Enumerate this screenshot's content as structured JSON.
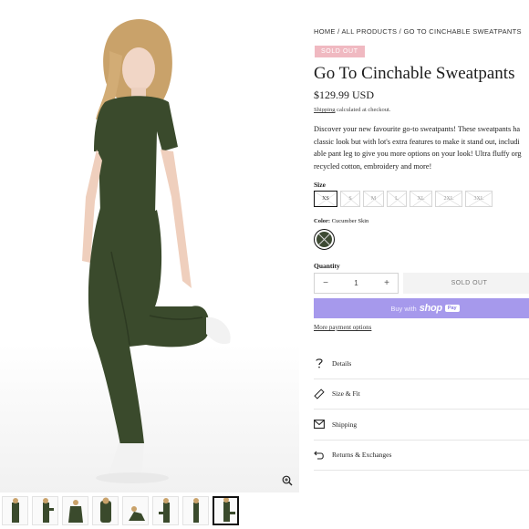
{
  "breadcrumb": {
    "home": "HOME",
    "sep1": " / ",
    "all": "ALL PRODUCTS",
    "sep2": " / ",
    "current": "GO TO CINCHABLE SWEATPANTS"
  },
  "badge": "SOLD OUT",
  "product": {
    "title": "Go To Cinchable Sweatpants",
    "price": "$129.99 USD",
    "shipping_link": "Shipping",
    "shipping_text": " calculated at checkout.",
    "description_lines": [
      "Discover your new favourite go-to sweatpants! These sweatpants ha",
      "classic look but with lot's extra features to make it stand out, includi",
      "able pant leg to give you more options on your look! Ultra fluffy org",
      "recycled cotton, embroidery and more!"
    ]
  },
  "size": {
    "label": "Size",
    "options": [
      "XS",
      "S",
      "M",
      "L",
      "XL",
      "2XL",
      "3XL"
    ],
    "selected": "XS"
  },
  "color": {
    "label": "Color:",
    "value": "Cucumber Skin",
    "swatch": "#3d4a33"
  },
  "quantity": {
    "label": "Quantity",
    "value": "1",
    "minus": "−",
    "plus": "+"
  },
  "buttons": {
    "sold_out": "SOLD OUT",
    "buy_with": "Buy with",
    "shop_logo": "shop",
    "pay": "Pay",
    "more_payment": "More payment options"
  },
  "accordion": [
    {
      "label": "Details",
      "icon": "question-icon"
    },
    {
      "label": "Size & Fit",
      "icon": "ruler-icon"
    },
    {
      "label": "Shipping",
      "icon": "envelope-icon"
    },
    {
      "label": "Returns & Exchanges",
      "icon": "return-arrow-icon"
    }
  ],
  "thumbnails": [
    "front",
    "side",
    "pose",
    "back",
    "sitting",
    "walk",
    "stand",
    "kick"
  ],
  "colors": {
    "accent_shop": "#a699ec",
    "badge": "#f0b9c1",
    "garment": "#3a4a2c"
  }
}
